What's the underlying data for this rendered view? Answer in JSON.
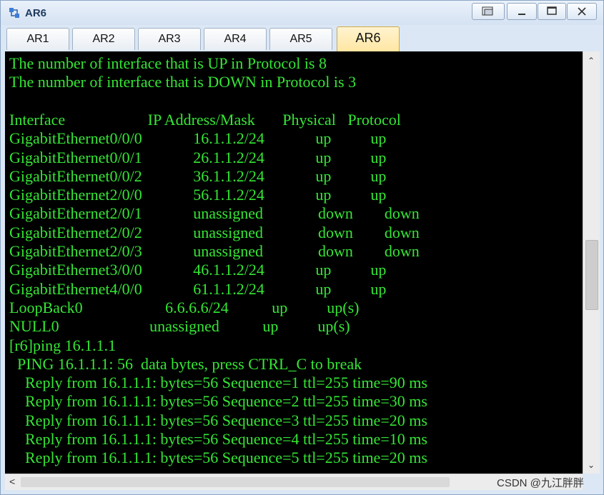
{
  "window": {
    "title": "AR6",
    "app_icon": "router-app-icon",
    "controls": [
      "restore-icon",
      "minimize-icon",
      "maximize-icon",
      "close-icon"
    ]
  },
  "tabs": [
    {
      "label": "AR1",
      "active": false
    },
    {
      "label": "AR2",
      "active": false
    },
    {
      "label": "AR3",
      "active": false
    },
    {
      "label": "AR4",
      "active": false
    },
    {
      "label": "AR5",
      "active": false
    },
    {
      "label": "AR6",
      "active": true
    }
  ],
  "terminal": {
    "lines": [
      "The number of interface that is UP in Protocol is 8",
      "The number of interface that is DOWN in Protocol is 3",
      "",
      "Interface                     IP Address/Mask       Physical   Protocol",
      "GigabitEthernet0/0/0             16.1.1.2/24             up          up",
      "GigabitEthernet0/0/1             26.1.1.2/24             up          up",
      "GigabitEthernet0/0/2             36.1.1.2/24             up          up",
      "GigabitEthernet2/0/0             56.1.1.2/24             up          up",
      "GigabitEthernet2/0/1             unassigned              down        down",
      "GigabitEthernet2/0/2             unassigned              down        down",
      "GigabitEthernet2/0/3             unassigned              down        down",
      "GigabitEthernet3/0/0             46.1.1.2/24             up          up",
      "GigabitEthernet4/0/0             61.1.1.2/24             up          up",
      "LoopBack0                     6.6.6.6/24           up          up(s)",
      "NULL0                       unassigned           up          up(s)",
      "[r6]ping 16.1.1.1",
      "  PING 16.1.1.1: 56  data bytes, press CTRL_C to break",
      "    Reply from 16.1.1.1: bytes=56 Sequence=1 ttl=255 time=90 ms",
      "    Reply from 16.1.1.1: bytes=56 Sequence=2 ttl=255 time=30 ms",
      "    Reply from 16.1.1.1: bytes=56 Sequence=3 ttl=255 time=20 ms",
      "    Reply from 16.1.1.1: bytes=56 Sequence=4 ttl=255 time=10 ms",
      "    Reply from 16.1.1.1: bytes=56 Sequence=5 ttl=255 time=20 ms"
    ]
  },
  "watermark": "CSDN @九江胖胖"
}
